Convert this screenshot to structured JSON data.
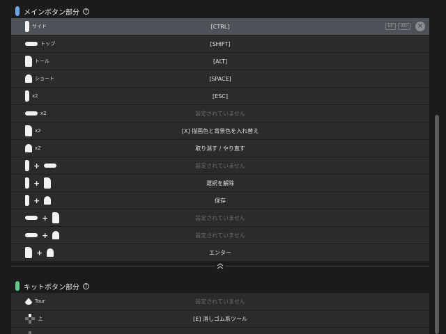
{
  "main_section": {
    "title": "メインボタン部分",
    "help": "?",
    "pill_color": "#6aa8ee"
  },
  "kit_section": {
    "title": "キットボタン部分",
    "help": "?",
    "pill_color": "#5fc88a"
  },
  "main_rows": [
    {
      "label": "サイド",
      "action": "[CTRL]",
      "unset": false,
      "selected": true
    },
    {
      "label": "トップ",
      "action": "[SHIFT]",
      "unset": false
    },
    {
      "label": "トール",
      "action": "[ALT]",
      "unset": false
    },
    {
      "label": "ショート",
      "action": "[SPACE]",
      "unset": false
    },
    {
      "label": "x2",
      "action": "[ESC]",
      "unset": false
    },
    {
      "label": "x2",
      "action": "設定されていません",
      "unset": true
    },
    {
      "label": "x2",
      "action": "[X] 描画色と背景色を入れ替え",
      "unset": false
    },
    {
      "label": "x2",
      "action": "取り消す / やり直す",
      "unset": false
    },
    {
      "label": "",
      "action": "設定されていません",
      "unset": true
    },
    {
      "label": "",
      "action": "選択を解除",
      "unset": false
    },
    {
      "label": "",
      "action": "保存",
      "unset": false
    },
    {
      "label": "",
      "action": "設定されていません",
      "unset": true
    },
    {
      "label": "",
      "action": "設定されていません",
      "unset": true
    },
    {
      "label": "",
      "action": "エンター",
      "unset": false
    }
  ],
  "kit_rows": [
    {
      "label": "Tour",
      "action": "設定されていません",
      "unset": true
    },
    {
      "label": "上",
      "action": "[E] 消しゴム系ツール",
      "unset": false
    },
    {
      "label": "",
      "action": "",
      "unset": false
    }
  ],
  "plus": "+",
  "selected_row": {
    "badge_up": "UP",
    "badge_rep": "REP",
    "close": "×"
  },
  "icons": {
    "collapse": "chevron-up-double-icon",
    "help": "question-circle-icon"
  },
  "colors": {
    "background": "#1b1b1b",
    "row": "#2b2b2b",
    "row_selected": "#4c5257",
    "unset_text": "#6d6d6d"
  }
}
